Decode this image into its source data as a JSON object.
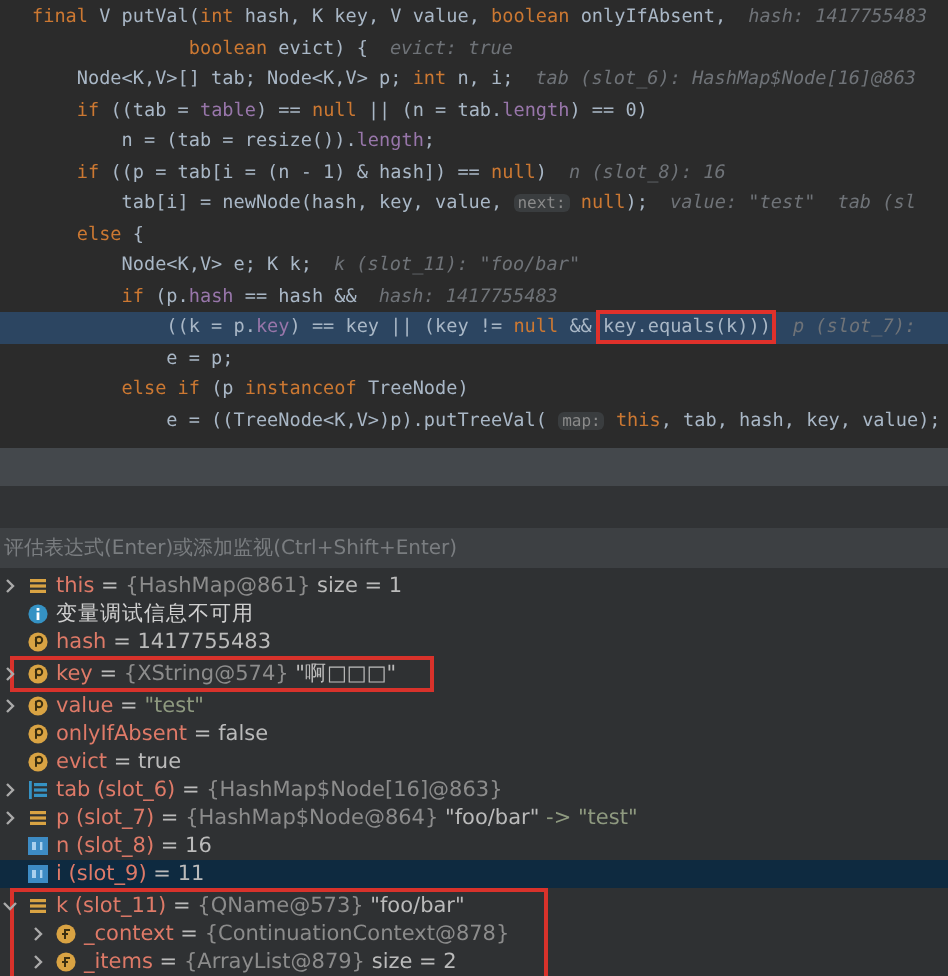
{
  "editor": {
    "lines": [
      {
        "current": false,
        "code": "**final** V putVal(**int** hash, K key, V value, **boolean** onlyIfAbsent,",
        "hints": [
          "hash: 1417755483"
        ]
      },
      {
        "current": false,
        "code": "              **boolean** evict) {",
        "hints": [
          "evict: true"
        ]
      },
      {
        "current": false,
        "code": "    Node<K,V>[] tab; Node<K,V> p; **int** n, i;",
        "hints": [
          "tab (slot_6): HashMap$Node[16]@863"
        ]
      },
      {
        "current": false,
        "code": "    **if** ((tab = *table*) == **null** || (n = tab.*length*) == 0)"
      },
      {
        "current": false,
        "code": "        n = (tab = resize()).*length*;"
      },
      {
        "current": false,
        "code": "    **if** ((p = tab[i = (n - 1) & hash]) == **null**)",
        "hints": [
          "n (slot_8): 16"
        ]
      },
      {
        "current": false,
        "code": "        tab[i] = newNode(hash, key, value,",
        "param_hint": "next:",
        "code_after": "**null**);",
        "hints": [
          "value: \"test\"",
          "tab (sl"
        ]
      },
      {
        "current": false,
        "code": "    **else** {"
      },
      {
        "current": false,
        "code": "        Node<K,V> e; K k;",
        "hints": [
          "k (slot_11): \"foo/bar\""
        ]
      },
      {
        "current": false,
        "code": "        **if** (p.*hash* == hash &&",
        "hints": [
          "hash: 1417755483"
        ]
      },
      {
        "current": true,
        "code": "            ((k = p.*key*) == key || (key != **null** &&",
        "boxed_code": "key.equals(k)))",
        "hints": [
          "p (slot_7):"
        ]
      },
      {
        "current": false,
        "code": "            e = p;"
      },
      {
        "current": false,
        "code": "        **else if** (p **instanceof** TreeNode)"
      },
      {
        "current": false,
        "code": "            e = ((TreeNode<K,V>)p).putTreeVal(",
        "param_hint": "map:",
        "code_after": "**this**, tab, hash, key, value);"
      }
    ]
  },
  "evaluate": {
    "placeholder": "评估表达式(Enter)或添加监视(Ctrl+Shift+Enter)"
  },
  "variables": {
    "assignment_sign": "=",
    "rows": [
      {
        "kind": "object",
        "name": "this",
        "type": "{HashMap@861}",
        "value": "size = 1",
        "expanded": false,
        "selected": false,
        "outlined": false
      },
      {
        "kind": "info",
        "message": "变量调试信息不可用",
        "selected": false,
        "outlined": false
      },
      {
        "kind": "param",
        "name": "hash",
        "value": "1417755483",
        "selected": false,
        "outlined": false
      },
      {
        "kind": "param",
        "name": "key",
        "type": "{XString@574}",
        "value": "\"啊□□□\"",
        "expanded": false,
        "selected": false,
        "outlined": true
      },
      {
        "kind": "param",
        "name": "value",
        "note": "\"test\"",
        "expanded": false,
        "selected": false,
        "outlined": false
      },
      {
        "kind": "param",
        "name": "onlyIfAbsent",
        "value": "false",
        "selected": false,
        "outlined": false
      },
      {
        "kind": "param",
        "name": "evict",
        "value": "true",
        "selected": false,
        "outlined": false
      },
      {
        "kind": "array",
        "name": "tab (slot_6)",
        "type": "{HashMap$Node[16]@863}",
        "expanded": false,
        "selected": false,
        "outlined": false
      },
      {
        "kind": "object",
        "name": "p (slot_7)",
        "type": "{HashMap$Node@864}",
        "value": "\"foo/bar\"",
        "note": "-> \"test\"",
        "expanded": false,
        "selected": false,
        "outlined": false
      },
      {
        "kind": "int",
        "name": "n (slot_8)",
        "value": "16",
        "selected": false,
        "outlined": false
      },
      {
        "kind": "int",
        "name": "i (slot_9)",
        "value": "11",
        "selected": true,
        "outlined": false
      },
      {
        "kind": "object",
        "name": "k (slot_11)",
        "type": "{QName@573}",
        "value": "\"foo/bar\"",
        "expanded": true,
        "selected": false,
        "outlined": true,
        "children": [
          {
            "kind": "field",
            "name": "_context",
            "type": "{ContinuationContext@878}",
            "expanded": false,
            "selected": false,
            "outlined": false
          },
          {
            "kind": "field",
            "name": "_items",
            "type": "{ArrayList@879}",
            "value": "size = 2",
            "expanded": false,
            "selected": false,
            "outlined": false
          }
        ]
      }
    ]
  }
}
